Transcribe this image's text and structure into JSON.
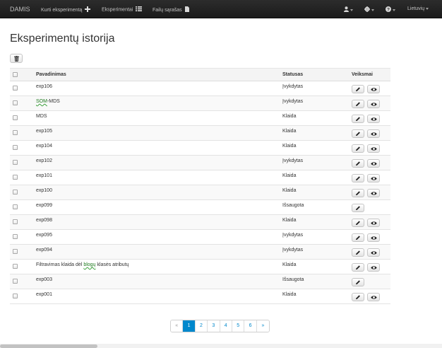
{
  "navbar": {
    "brand": "DAMIS",
    "items": [
      {
        "label": "Kurti eksperimentą",
        "icon": "plus-icon"
      },
      {
        "label": "Eksperimentai",
        "icon": "list-icon"
      },
      {
        "label": "Failų sąrašas",
        "icon": "file-icon"
      }
    ],
    "right": [
      {
        "icon": "user-icon"
      },
      {
        "icon": "gear-icon"
      },
      {
        "icon": "help-icon"
      },
      {
        "label": "Lietuvių"
      }
    ]
  },
  "page": {
    "title": "Eksperimentų istorija"
  },
  "toolbar": {
    "delete_icon": "trash-icon"
  },
  "table": {
    "headers": {
      "name": "Pavadinimas",
      "status": "Statusas",
      "actions": "Veiksmai"
    },
    "rows": [
      {
        "name": "exp106",
        "status": "Įvykdytas",
        "actions": [
          "edit",
          "view"
        ]
      },
      {
        "name_parts": [
          "SOM",
          "-MDS"
        ],
        "status": "Įvykdytas",
        "actions": [
          "edit",
          "view"
        ]
      },
      {
        "name": "MDS",
        "status": "Klaida",
        "actions": [
          "edit",
          "view"
        ]
      },
      {
        "name": "exp105",
        "status": "Klaida",
        "actions": [
          "edit",
          "view"
        ]
      },
      {
        "name": "exp104",
        "status": "Klaida",
        "actions": [
          "edit",
          "view"
        ]
      },
      {
        "name": "exp102",
        "status": "Įvykdytas",
        "actions": [
          "edit",
          "view"
        ]
      },
      {
        "name": "exp101",
        "status": "Klaida",
        "actions": [
          "edit",
          "view"
        ]
      },
      {
        "name": "exp100",
        "status": "Klaida",
        "actions": [
          "edit",
          "view"
        ]
      },
      {
        "name": "exp099",
        "status": "Išsaugota",
        "actions": [
          "edit"
        ]
      },
      {
        "name": "exp098",
        "status": "Klaida",
        "actions": [
          "edit",
          "view"
        ]
      },
      {
        "name": "exp095",
        "status": "Įvykdytas",
        "actions": [
          "edit",
          "view"
        ]
      },
      {
        "name": "exp094",
        "status": "Įvykdytas",
        "actions": [
          "edit",
          "view"
        ]
      },
      {
        "name_parts": [
          "Filtravimas klaida dėl ",
          "blogų",
          " klasės atributų"
        ],
        "status": "Klaida",
        "actions": [
          "edit",
          "view"
        ]
      },
      {
        "name": "exp003",
        "status": "Išsaugota",
        "actions": [
          "edit"
        ]
      },
      {
        "name": "exp001",
        "status": "Klaida",
        "actions": [
          "edit",
          "view"
        ]
      }
    ]
  },
  "pagination": {
    "prev": "«",
    "pages": [
      "1",
      "2",
      "3",
      "4",
      "5",
      "6"
    ],
    "next": "»",
    "current": "1"
  },
  "colors": {
    "accent": "#0088cc",
    "navbar": "#222222"
  }
}
